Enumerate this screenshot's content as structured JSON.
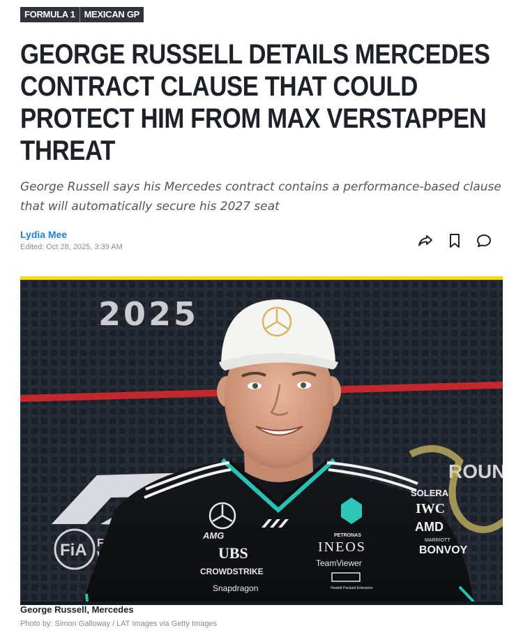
{
  "tags": [
    "FORMULA 1",
    "MEXICAN GP"
  ],
  "headline": "GEORGE RUSSELL DETAILS MERCEDES CONTRACT CLAUSE THAT COULD PROTECT HIM FROM MAX VERSTAPPEN THREAT",
  "subheadline": "George Russell says his Mercedes contract contains a performance-based clause that will automatically secure his 2027 seat",
  "author": "Lydia Mee",
  "edited": "Edited: Oct 28, 2025, 3:39 AM",
  "actions": [
    "share-icon",
    "bookmark-icon",
    "comment-icon"
  ],
  "photo": {
    "backdrop_year": "2025",
    "backdrop_round": "ROUN",
    "backdrop_fia": "FiA",
    "backdrop_fia_text": "FIA F\nWor",
    "shirt_sponsors": [
      "AMG",
      "UBS",
      "CROWDSTRIKE",
      "Snapdragon",
      "PETRONAS",
      "INEOS",
      "TeamViewer",
      "Hewlett Packard Enterprise",
      "SOLERA",
      "IWC",
      "AMD",
      "MARRIOTT",
      "BONVOY"
    ]
  },
  "caption": "George Russell, Mercedes",
  "credit": "Photo by: Simon Galloway / LAT Images via Getty Images",
  "colors": {
    "accent_yellow": "#ffd800",
    "author_blue": "#1f7fe0",
    "tag_bg": "#2f333a"
  }
}
